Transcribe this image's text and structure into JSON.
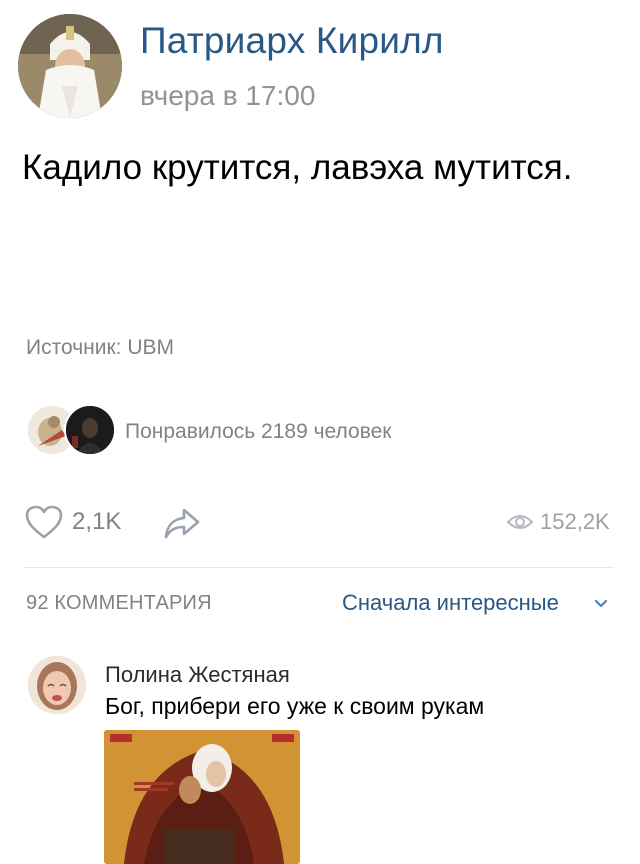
{
  "post": {
    "author": "Патриарх Кирилл",
    "time": "вчера в 17:00",
    "text": "Кадило крутится, лавэха мутится.",
    "source": "Источник: UBM"
  },
  "likers": {
    "text": "Понравилось 2189 человек"
  },
  "actions": {
    "likes": "2,1K",
    "views": "152,2K"
  },
  "comments": {
    "count_label": "92 КОММЕНТАРИЯ",
    "sort_label": "Сначала интересные",
    "items": [
      {
        "author": "Полина Жестяная",
        "text": "Бог, прибери его уже к своим рукам"
      }
    ]
  },
  "colors": {
    "link": "#2a5885",
    "secondary": "#828282"
  },
  "icons": [
    "heart-icon",
    "share-icon",
    "eye-icon",
    "chevron-down-icon"
  ]
}
